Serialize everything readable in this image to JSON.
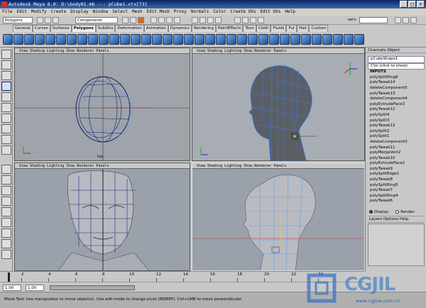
{
  "window": {
    "title": "Autodesk Maya 8.0: D:\\body01.mb  ---  pCube1.vtx[73]",
    "min": "_",
    "max": "□",
    "close": "×"
  },
  "menubar": [
    "File",
    "Edit",
    "Modify",
    "Create",
    "Display",
    "Window",
    "Select",
    "Mesh",
    "Edit Mesh",
    "Proxy",
    "Normals",
    "Color",
    "Create UVs",
    "Edit UVs",
    "Help"
  ],
  "status_line": {
    "menu_set": "Polygons",
    "selection_mask": "Components",
    "sel_label": "sel+"
  },
  "shelf_tabs": [
    "General",
    "Curves",
    "Surfaces",
    "Polygons",
    "Subdivs",
    "Deformation",
    "Animation",
    "Dynamics",
    "Rendering",
    "PaintEffects",
    "Toon",
    "Cloth",
    "Fluids",
    "Fur",
    "Hair",
    "Custom"
  ],
  "active_shelf_tab": "Polygons",
  "panel_menu": "View  Shading  Lighting  Show  Renderer  Panels",
  "panels": [
    {
      "name": "top-left",
      "camera": "top"
    },
    {
      "name": "top-right",
      "camera": ""
    },
    {
      "name": "bottom-left",
      "camera": ""
    },
    {
      "name": "bottom-right",
      "camera": ""
    }
  ],
  "channel_box": {
    "tabs": "Channels  Object",
    "shape": "pCubeShape1",
    "cvs": "CVs (click to show)",
    "inputs_label": "INPUTS",
    "inputs": [
      "polySplitRing6",
      "polyTweak14",
      "deleteComponent5",
      "polyTweak13",
      "deleteComponent4",
      "polyExtrudeFace3",
      "polyTweak12",
      "polySplit4",
      "polySplit3",
      "polyTweak12",
      "polySplit2",
      "polySplit1",
      "deleteComponent3",
      "polyTweak11",
      "polyMergeVert2",
      "polyTweak10",
      "polyExtrudeFace2",
      "polyTweak9",
      "polySplitEdge1",
      "polyTweak8",
      "polySplitRing5",
      "polyTweak7",
      "polySplitRing4",
      "polyTweak6"
    ]
  },
  "layer_editor": {
    "display": "Display",
    "render": "Render",
    "menu": "Layers  Options  Help"
  },
  "time_slider": {
    "ticks": [
      "2",
      "4",
      "6",
      "8",
      "10",
      "12",
      "14",
      "16",
      "18",
      "20",
      "22",
      "24"
    ],
    "range_start": "1.00",
    "range_start2": "1.00"
  },
  "help_line": "Move Tool: Use manipulator to move object(s). Use edit mode to change pivot (INSERT). Ctrl+LMB to move perpendicular.",
  "watermark": {
    "brand": "CGJIL",
    "url": "www.cgjiue.com.cn"
  }
}
